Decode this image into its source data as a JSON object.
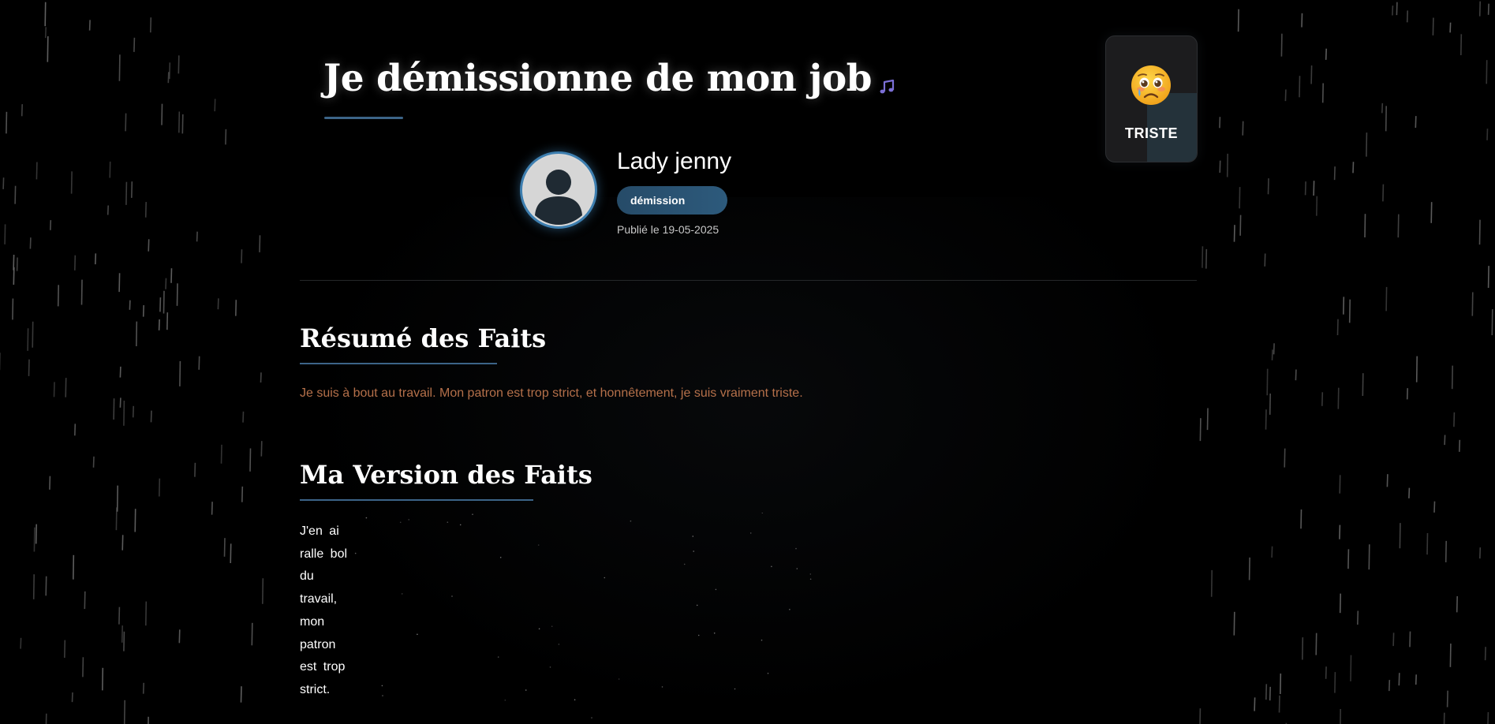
{
  "header": {
    "title": "Je démissionne de mon job",
    "music_icon": "music-note-icon"
  },
  "mood": {
    "emoji": "sad-teary-face-icon",
    "label": "TRISTE"
  },
  "author": {
    "avatar_icon": "user-silhouette-icon",
    "name": "Lady jenny",
    "tag": "démission",
    "published": "Publié le 19-05-2025"
  },
  "sections": {
    "summary": {
      "title": "Résumé des Faits",
      "text": "Je suis à bout au travail. Mon patron est trop strict, et honnêtement, je suis vraiment triste."
    },
    "version": {
      "title": "Ma Version des Faits",
      "text": "J'en ai ralle bol du travail, mon patron est trop strict."
    }
  },
  "colors": {
    "background": "#000000",
    "accent": "#3c6488",
    "badge": "#2d5a7c",
    "summary_text": "#b5704a",
    "rain": "#6a6a6a"
  }
}
